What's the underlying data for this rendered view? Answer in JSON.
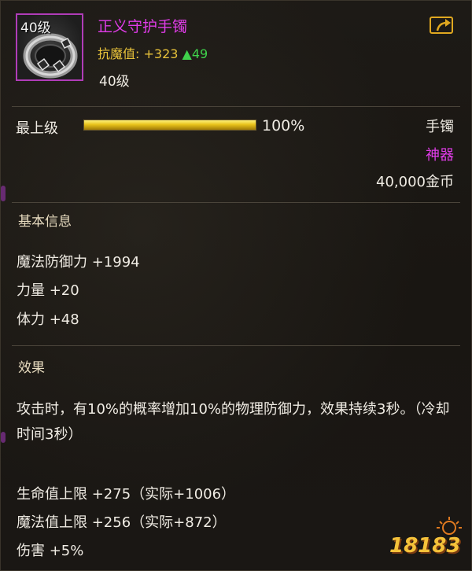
{
  "item": {
    "icon_level_badge": "40级",
    "name": "正义守护手镯",
    "attr_label": "抗魔值:",
    "attr_value": "+323",
    "attr_up": "▲49",
    "level_text": "40级"
  },
  "upgrade": {
    "label": "最上级",
    "progress": 1.0,
    "percent_text": "100%"
  },
  "meta": {
    "slot": "手镯",
    "rarity": "神器",
    "price": "40,000金币"
  },
  "basic_info": {
    "title": "基本信息",
    "stats": [
      "魔法防御力 +1994",
      "力量 +20",
      "体力 +48"
    ]
  },
  "effect": {
    "title": "效果",
    "description": "攻击时，有10%的概率增加10%的物理防御力，效果持续3秒。（冷却时间3秒）",
    "bonuses": [
      "生命值上限 +275（实际+1006）",
      "魔法值上限 +256（实际+872）",
      "伤害 +5%"
    ]
  },
  "watermark": {
    "text": "18183"
  },
  "colors": {
    "epic_purple": "#e03ce8",
    "gold": "#e8c23a",
    "up_green": "#3fd24b",
    "text": "#f0ece4"
  },
  "icons": {
    "share": "share-external-icon",
    "item": "bracelet-icon"
  }
}
